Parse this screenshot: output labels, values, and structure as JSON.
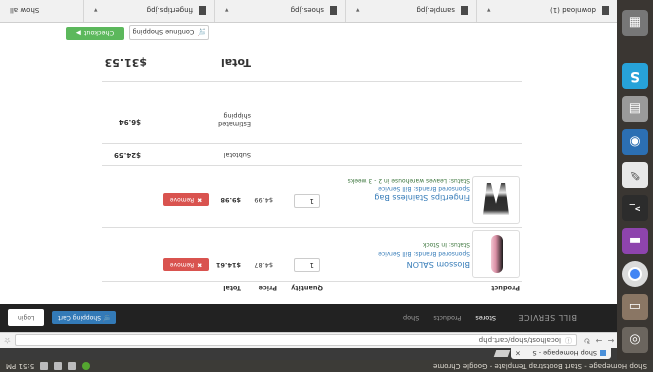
{
  "os_panel": {
    "title": "Shop Homepage - Start Bootstrap Template - Google Chrome",
    "time": "5:51 PM"
  },
  "launcher": {
    "items": [
      "dash-icon",
      "files-icon",
      "chrome-icon",
      "purple-app-icon",
      "terminal-icon",
      "doc-icon",
      "blue-app-icon",
      "gray-app-icon",
      "skype-icon",
      "workspace-icon"
    ]
  },
  "browser": {
    "tab_title": "Shop Homepage - S",
    "tab_close": "×",
    "url": "localhost/shop/cart.php"
  },
  "site": {
    "brand": "BILL SERVICE",
    "nav": [
      "Stores",
      "Products",
      "Shop"
    ],
    "cart_label": "Shopping Cart",
    "login_label": "Login"
  },
  "cart": {
    "headers": {
      "product": "Product",
      "quantity": "Quantity",
      "price": "Price",
      "total": "Total"
    },
    "items": [
      {
        "name": "Blossom SALON",
        "brand": "Sponsored Brands: Bill Service",
        "status": "Status: In Stock",
        "qty": "1",
        "price": "$4.87",
        "total": "$14.61",
        "remove": "Remove"
      },
      {
        "name": "Fingertips Stainless Bag",
        "brand": "Sponsored Brands: Bill Service",
        "status": "Status: Leaves warehouse in 2 - 3 weeks",
        "qty": "1",
        "price": "$4.99",
        "total": "$9.98",
        "remove": "Remove"
      }
    ],
    "subtotal_label": "Subtotal",
    "subtotal_value": "$24.59",
    "shipping_label": "Estimated shipping",
    "shipping_value": "$6.94",
    "total_label": "Total",
    "total_value": "$31.53",
    "continue_label": "Continue Shopping",
    "checkout_label": "Checkout"
  },
  "downloads": {
    "items": [
      "download (1)",
      "sample.jpg",
      "shoes.jpg",
      "fingertips.jpg"
    ],
    "show_all": "Show all"
  }
}
